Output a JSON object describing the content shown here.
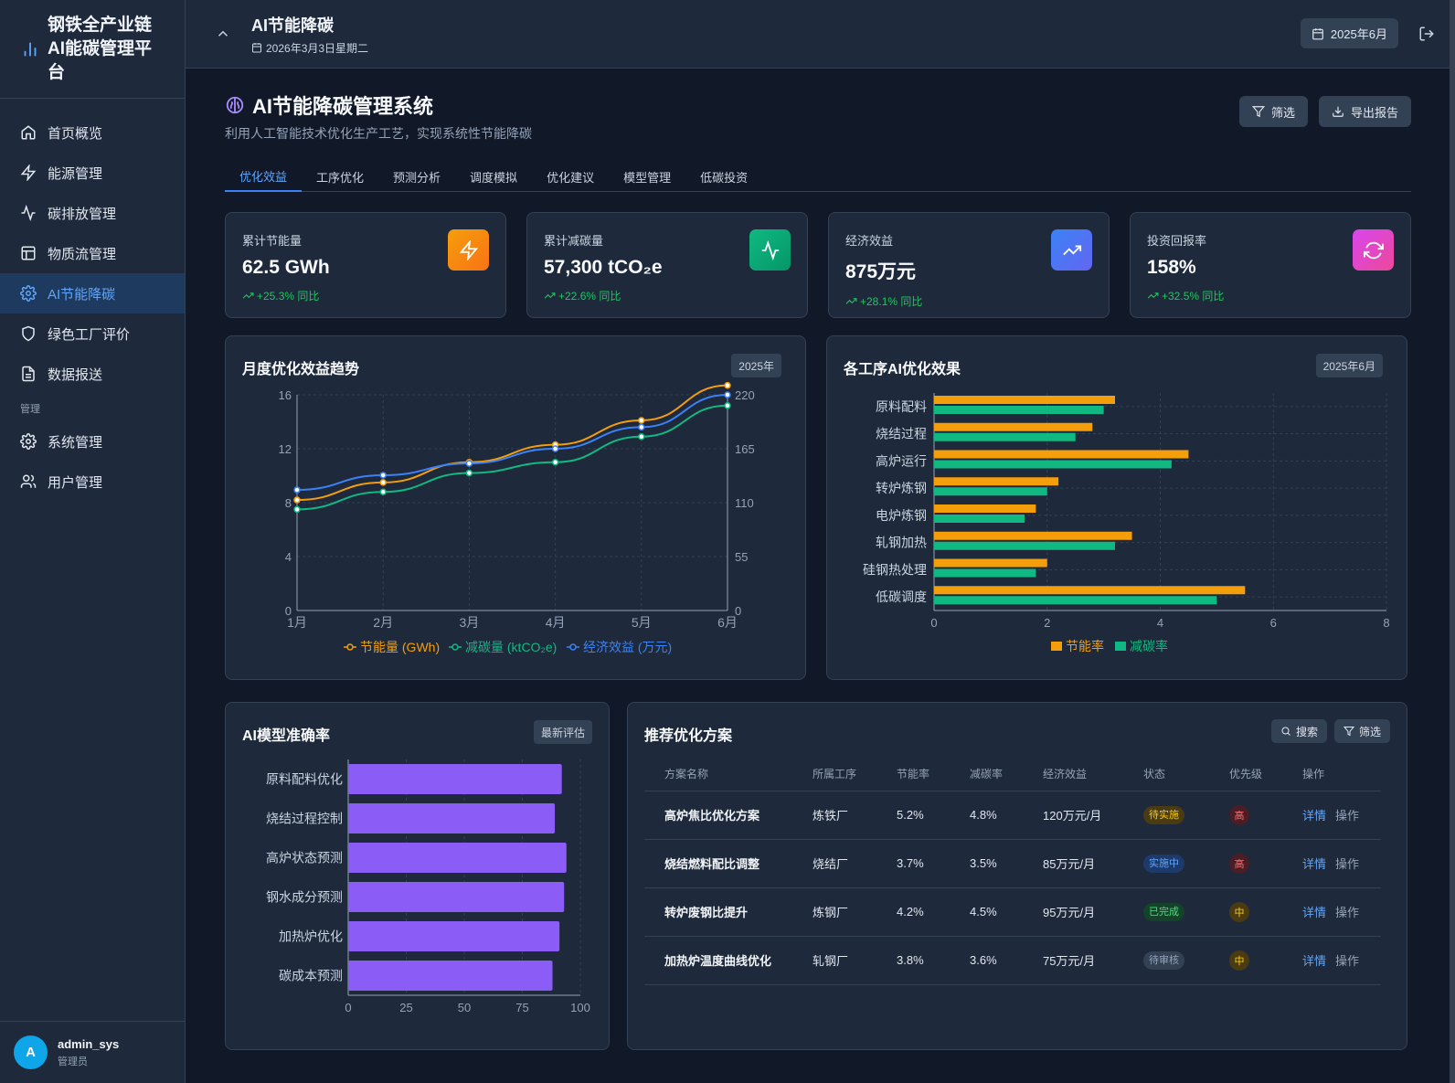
{
  "sidebar": {
    "brand": "钢铁全产业链AI能碳管理平台",
    "items": [
      {
        "label": "首页概览",
        "icon": "home-icon"
      },
      {
        "label": "能源管理",
        "icon": "bolt-icon"
      },
      {
        "label": "碳排放管理",
        "icon": "activity-icon"
      },
      {
        "label": "物质流管理",
        "icon": "layout-icon"
      },
      {
        "label": "AI节能降碳",
        "icon": "gear-icon"
      },
      {
        "label": "绿色工厂评价",
        "icon": "shield-icon"
      },
      {
        "label": "数据报送",
        "icon": "file-icon"
      }
    ],
    "section": "管理",
    "admin_items": [
      {
        "label": "系统管理",
        "icon": "gear-icon"
      },
      {
        "label": "用户管理",
        "icon": "users-icon"
      }
    ],
    "user": {
      "initial": "A",
      "name": "admin_sys",
      "role": "管理员"
    }
  },
  "topbar": {
    "title": "AI节能降碳",
    "date": "2026年3月3日星期二",
    "month": "2025年6月"
  },
  "page": {
    "title": "AI节能降碳管理系统",
    "subtitle": "利用人工智能技术优化生产工艺，实现系统性节能降碳",
    "filter_label": "筛选",
    "export_label": "导出报告"
  },
  "tabs": [
    "优化效益",
    "工序优化",
    "预测分析",
    "调度模拟",
    "优化建议",
    "模型管理",
    "低碳投资"
  ],
  "kpis": [
    {
      "label": "累计节能量",
      "value": "62.5 GWh",
      "change": "+25.3% 同比",
      "color": "#f59e0b",
      "icon": "bolt-icon"
    },
    {
      "label": "累计减碳量",
      "value": "57,300 tCO₂e",
      "change": "+22.6% 同比",
      "color": "#10b981",
      "icon": "activity-icon"
    },
    {
      "label": "经济效益",
      "value": "875万元",
      "change": "+28.1% 同比",
      "color": "#3b82f6",
      "icon": "trending-up-icon"
    },
    {
      "label": "投资回报率",
      "value": "158%",
      "change": "+32.5% 同比",
      "color": "#d946ef",
      "icon": "refresh-icon"
    }
  ],
  "panels": {
    "trend": {
      "title": "月度优化效益趋势",
      "tag": "2025年"
    },
    "process": {
      "title": "各工序AI优化效果",
      "tag": "2025年6月"
    },
    "accuracy": {
      "title": "AI模型准确率",
      "tag": "最新评估"
    },
    "plans": {
      "title": "推荐优化方案",
      "search_label": "搜索",
      "filter_label": "筛选"
    }
  },
  "chart_data": [
    {
      "type": "line",
      "x": [
        "1月",
        "2月",
        "3月",
        "4月",
        "5月",
        "6月"
      ],
      "ylim_left": [
        0,
        16
      ],
      "yticks_left": [
        0,
        4,
        8,
        12,
        16
      ],
      "ylim_right": [
        0,
        220
      ],
      "yticks_right": [
        0,
        55,
        110,
        165,
        220
      ],
      "series": [
        {
          "name": "节能量 (GWh)",
          "axis": "left",
          "color": "#f59e0b",
          "values": [
            8.2,
            9.5,
            11.0,
            12.3,
            14.1,
            16.7
          ]
        },
        {
          "name": "减碳量 (ktCO₂e)",
          "axis": "left",
          "color": "#10b981",
          "values": [
            7.5,
            8.8,
            10.2,
            11.0,
            12.9,
            15.2
          ]
        },
        {
          "name": "经济效益 (万元)",
          "axis": "right",
          "color": "#3b82f6",
          "values": [
            123,
            138,
            150,
            165,
            187,
            220
          ]
        }
      ],
      "grid": true,
      "legend": "bottom"
    },
    {
      "type": "bar",
      "orientation": "horizontal",
      "categories": [
        "原料配料",
        "烧结过程",
        "高炉运行",
        "转炉炼钢",
        "电炉炼钢",
        "轧钢加热",
        "硅钢热处理",
        "低碳调度"
      ],
      "xlim": [
        0,
        8
      ],
      "xticks": [
        0,
        2,
        4,
        6,
        8
      ],
      "series": [
        {
          "name": "节能率",
          "color": "#f59e0b",
          "values": [
            3.2,
            2.8,
            4.5,
            2.2,
            1.8,
            3.5,
            2.0,
            5.5
          ]
        },
        {
          "name": "减碳率",
          "color": "#10b981",
          "values": [
            3.0,
            2.5,
            4.2,
            2.0,
            1.6,
            3.2,
            1.8,
            5.0
          ]
        }
      ],
      "grid": true,
      "legend": "bottom"
    },
    {
      "type": "bar",
      "orientation": "horizontal",
      "categories": [
        "原料配料优化",
        "烧结过程控制",
        "高炉状态预测",
        "钢水成分预测",
        "加热炉优化",
        "碳成本预测"
      ],
      "xlim": [
        0,
        100
      ],
      "xticks": [
        0,
        25,
        50,
        75,
        100
      ],
      "series": [
        {
          "color": "#8b5cf6",
          "values": [
            92,
            89,
            94,
            93,
            91,
            88
          ]
        }
      ],
      "grid": true
    }
  ],
  "plans_table": {
    "headers": [
      "方案名称",
      "所属工序",
      "节能率",
      "减碳率",
      "经济效益",
      "状态",
      "优先级",
      "操作"
    ],
    "rows": [
      {
        "name": "高炉焦比优化方案",
        "process": "炼铁厂",
        "energy": "5.2%",
        "carbon": "4.8%",
        "benefit": "120万元/月",
        "status": "待实施",
        "status_color": "#facc15",
        "status_bg": "#4a3b12",
        "priority": "高",
        "priority_color": "#f87171",
        "priority_bg": "#4c1d24",
        "detail": "详情",
        "action": "操作"
      },
      {
        "name": "烧结燃料配比调整",
        "process": "烧结厂",
        "energy": "3.7%",
        "carbon": "3.5%",
        "benefit": "85万元/月",
        "status": "实施中",
        "status_color": "#60a5fa",
        "status_bg": "#1e3a6b",
        "priority": "高",
        "priority_color": "#f87171",
        "priority_bg": "#4c1d24",
        "detail": "详情",
        "action": "操作"
      },
      {
        "name": "转炉废钢比提升",
        "process": "炼钢厂",
        "energy": "4.2%",
        "carbon": "4.5%",
        "benefit": "95万元/月",
        "status": "已完成",
        "status_color": "#4ade80",
        "status_bg": "#14432a",
        "priority": "中",
        "priority_color": "#facc15",
        "priority_bg": "#4a3b12",
        "detail": "详情",
        "action": "操作"
      },
      {
        "name": "加热炉温度曲线优化",
        "process": "轧钢厂",
        "energy": "3.8%",
        "carbon": "3.6%",
        "benefit": "75万元/月",
        "status": "待审核",
        "status_color": "#94a3b8",
        "status_bg": "#334155",
        "priority": "中",
        "priority_color": "#facc15",
        "priority_bg": "#4a3b12",
        "detail": "详情",
        "action": "操作"
      }
    ]
  }
}
